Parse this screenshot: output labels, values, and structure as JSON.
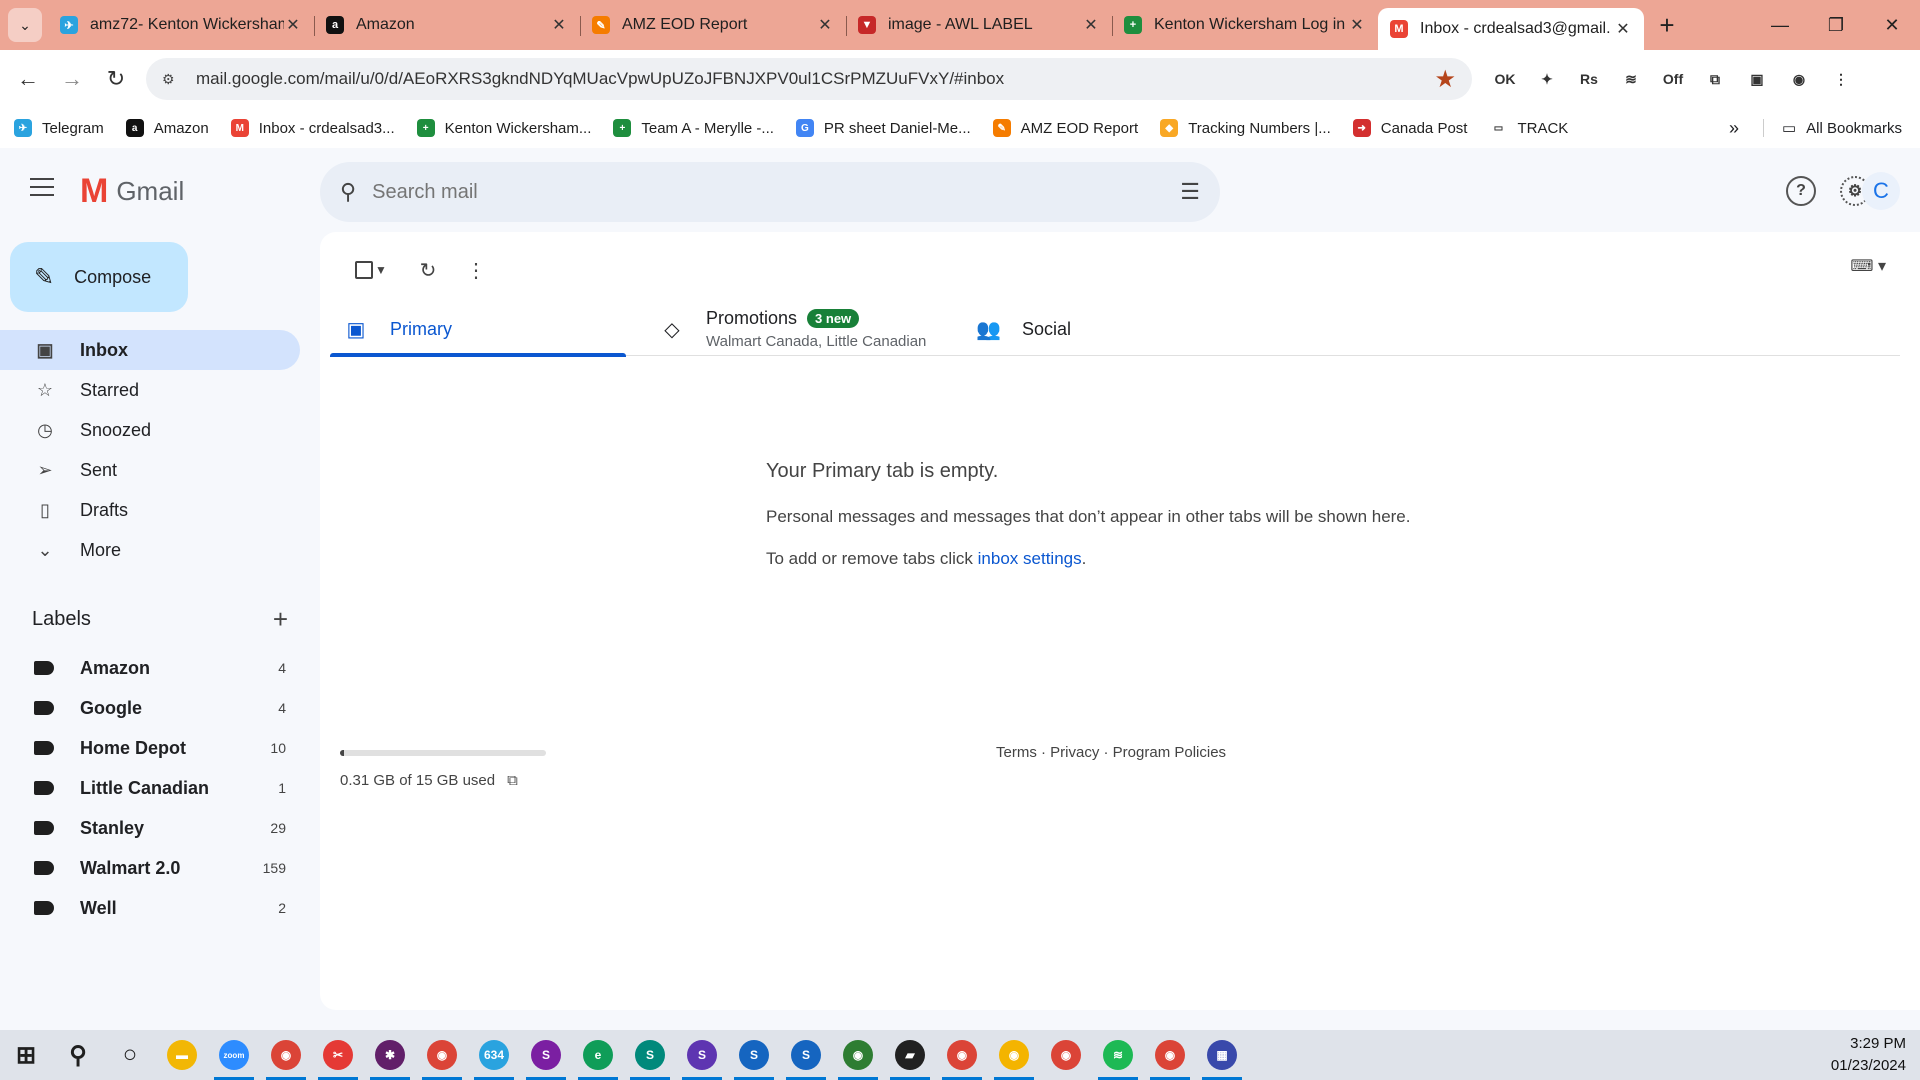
{
  "browser": {
    "tabs": [
      {
        "title": "amz72- Kenton Wickersham",
        "icon": "telegram-icon",
        "color": "#2aa3df",
        "glyph": "✈",
        "active": false
      },
      {
        "title": "Amazon",
        "icon": "amazon-icon",
        "color": "#111111",
        "glyph": "a",
        "active": false
      },
      {
        "title": "AMZ EOD Report",
        "icon": "forms-icon",
        "color": "#f57c00",
        "glyph": "✎",
        "active": false
      },
      {
        "title": "image - AWL LABEL",
        "icon": "label-icon",
        "color": "#c62828",
        "glyph": "▼",
        "active": false
      },
      {
        "title": "Kenton Wickersham Log in",
        "icon": "sheets-icon",
        "color": "#1e8e3e",
        "glyph": "+",
        "active": false
      },
      {
        "title": "Inbox - crdealsad3@gmail.",
        "icon": "gmail-icon",
        "color": "#ea4335",
        "glyph": "M",
        "active": true
      }
    ],
    "url": "mail.google.com/mail/u/0/d/AEoRXRS3gkndNDYqMUacVpwUpUZoJFBNJXPV0ul1CSrPMZUuFVxY/#inbox",
    "extensions": [
      "OK",
      "✦",
      "Rs",
      "≋",
      "Off",
      "⧉",
      "▣",
      "◉",
      "⋮"
    ],
    "bookmarks": [
      {
        "label": "Telegram",
        "color": "#2aa3df",
        "glyph": "✈"
      },
      {
        "label": "Amazon",
        "color": "#111111",
        "glyph": "a"
      },
      {
        "label": "Inbox - crdealsad3...",
        "color": "#ea4335",
        "glyph": "M"
      },
      {
        "label": "Kenton Wickersham...",
        "color": "#1e8e3e",
        "glyph": "+"
      },
      {
        "label": "Team A - Merylle -...",
        "color": "#1e8e3e",
        "glyph": "+"
      },
      {
        "label": "PR sheet Daniel-Me...",
        "color": "#4285f4",
        "glyph": "G"
      },
      {
        "label": "AMZ EOD Report",
        "color": "#f57c00",
        "glyph": "✎"
      },
      {
        "label": "Tracking Numbers |...",
        "color": "#f9a825",
        "glyph": "◆"
      },
      {
        "label": "Canada Post",
        "color": "#d32f2f",
        "glyph": "➜"
      },
      {
        "label": "TRACK",
        "color": "#ffffff",
        "glyph": "▭"
      }
    ],
    "all_bookmarks": "All Bookmarks"
  },
  "gmail": {
    "logo": "Gmail",
    "search_placeholder": "Search mail",
    "avatar_letter": "C",
    "compose": "Compose",
    "nav": [
      {
        "label": "Inbox",
        "icon": "inbox-icon",
        "glyph": "▣",
        "active": true
      },
      {
        "label": "Starred",
        "icon": "star-icon",
        "glyph": "☆",
        "active": false
      },
      {
        "label": "Snoozed",
        "icon": "clock-icon",
        "glyph": "◷",
        "active": false
      },
      {
        "label": "Sent",
        "icon": "send-icon",
        "glyph": "➢",
        "active": false
      },
      {
        "label": "Drafts",
        "icon": "draft-icon",
        "glyph": "▯",
        "active": false
      },
      {
        "label": "More",
        "icon": "chevron-down-icon",
        "glyph": "⌄",
        "active": false
      }
    ],
    "labels_title": "Labels",
    "labels": [
      {
        "name": "Amazon",
        "count": "4"
      },
      {
        "name": "Google",
        "count": "4"
      },
      {
        "name": "Home Depot",
        "count": "10"
      },
      {
        "name": "Little Canadian",
        "count": "1"
      },
      {
        "name": "Stanley",
        "count": "29"
      },
      {
        "name": "Walmart 2.0",
        "count": "159"
      },
      {
        "name": "Well",
        "count": "2"
      }
    ],
    "categories": {
      "primary": "Primary",
      "promotions": "Promotions",
      "promotions_badge": "3 new",
      "promotions_sub": "Walmart Canada, Little Canadian",
      "social": "Social"
    },
    "empty": {
      "title": "Your Primary tab is empty.",
      "desc": "Personal messages and messages that don’t appear in other tabs will be shown here.",
      "settings_prefix": "To add or remove tabs click ",
      "settings_link": "inbox settings",
      "settings_suffix": "."
    },
    "storage": {
      "text": "0.31 GB of 15 GB used",
      "fraction": 0.02
    },
    "footer": "Terms · Privacy · Program Policies"
  },
  "taskbar": {
    "apps": [
      {
        "name": "start",
        "color": "#1f1f1f",
        "glyph": "⊞"
      },
      {
        "name": "search",
        "color": "#1f1f1f",
        "glyph": "⚲"
      },
      {
        "name": "task-view",
        "color": "#1f1f1f",
        "glyph": "○"
      },
      {
        "name": "file-explorer",
        "color": "#f2b705",
        "glyph": "▬"
      },
      {
        "name": "zoom",
        "color": "#2d8cff",
        "glyph": "zoom"
      },
      {
        "name": "chrome",
        "color": "#db4437",
        "glyph": "◉"
      },
      {
        "name": "snip",
        "color": "#e53935",
        "glyph": "✂"
      },
      {
        "name": "slack",
        "color": "#611f69",
        "glyph": "✱"
      },
      {
        "name": "chrome-2",
        "color": "#db4437",
        "glyph": "◉"
      },
      {
        "name": "telegram",
        "color": "#2aa3df",
        "glyph": "634"
      },
      {
        "name": "chrome-3",
        "color": "#7b1fa2",
        "glyph": "S"
      },
      {
        "name": "edge",
        "color": "#0f9d58",
        "glyph": "e"
      },
      {
        "name": "chrome-4",
        "color": "#00897b",
        "glyph": "S"
      },
      {
        "name": "chrome-5",
        "color": "#5e35b1",
        "glyph": "S"
      },
      {
        "name": "chrome-6",
        "color": "#1565c0",
        "glyph": "S"
      },
      {
        "name": "chrome-7",
        "color": "#1565c0",
        "glyph": "S"
      },
      {
        "name": "chrome-8",
        "color": "#2e7d32",
        "glyph": "◉"
      },
      {
        "name": "sticky-notes",
        "color": "#212121",
        "glyph": "▰"
      },
      {
        "name": "chrome-9",
        "color": "#db4437",
        "glyph": "◉"
      },
      {
        "name": "chrome-10",
        "color": "#f4b400",
        "glyph": "◉"
      },
      {
        "name": "chrome-11",
        "color": "#db4437",
        "glyph": "◉"
      },
      {
        "name": "spotify",
        "color": "#1db954",
        "glyph": "≋"
      },
      {
        "name": "chrome-12",
        "color": "#db4437",
        "glyph": "◉"
      },
      {
        "name": "calculator",
        "color": "#3949ab",
        "glyph": "▦"
      }
    ],
    "time": "3:29 PM",
    "date": "01/23/2024"
  }
}
